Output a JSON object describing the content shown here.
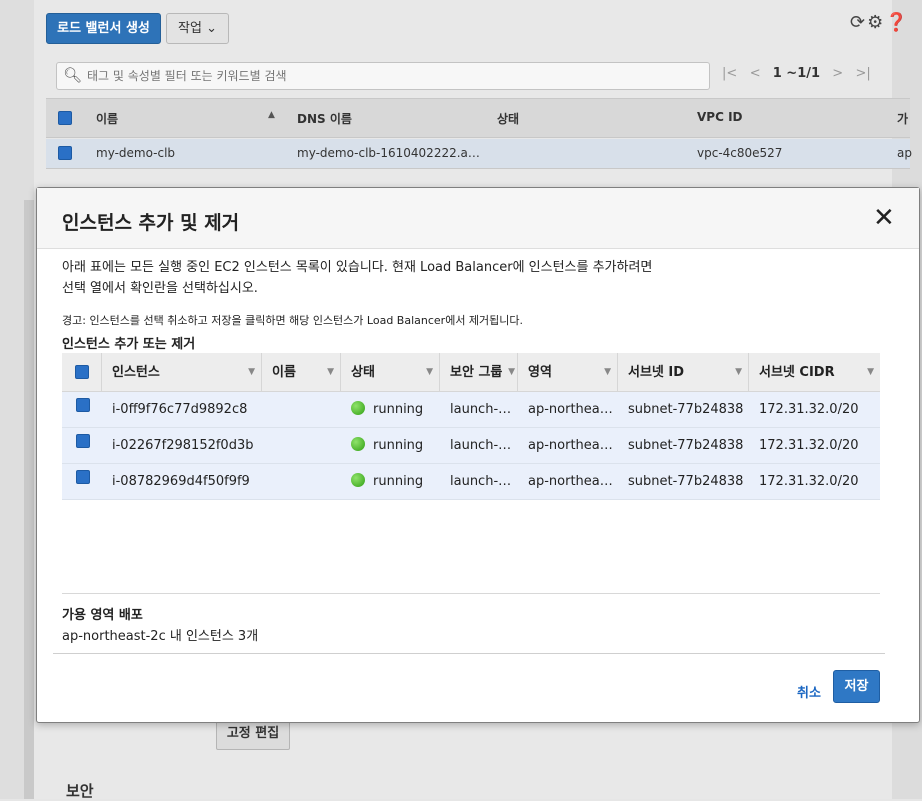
{
  "background": {
    "create_lb_button": "로드 밸런서 생성",
    "actions_button": "작업",
    "search_placeholder": "태그 및 속성별 필터 또는 키워드별 검색",
    "pagination": "1 ~1/1",
    "table": {
      "columns": [
        "이름",
        "DNS 이름",
        "상태",
        "VPC ID",
        "가"
      ],
      "row": {
        "name": "my-demo-clb",
        "dns": "my-demo-clb-1610402222.a…",
        "status": "",
        "vpc": "vpc-4c80e527",
        "extra": "ap"
      }
    },
    "edit_button": "고정 편집",
    "section_title": "보안"
  },
  "modal": {
    "title": "인스턴스 추가 및 제거",
    "close_glyph": "✕",
    "description_line1": "아래 표에는 모든 실행 중인 EC2 인스턴스 목록이 있습니다. 현재 Load Balancer에 인스턴스를 추가하려면",
    "description_line2": "선택 열에서 확인란을 선택하십시오.",
    "warning": "경고: 인스턴스를 선택 취소하고 저장을 클릭하면 해당 인스턴스가 Load Balancer에서 제거됩니다.",
    "section_title": "인스턴스 추가 또는 제거",
    "columns": [
      "인스턴스",
      "이름",
      "상태",
      "보안 그룹",
      "영역",
      "서브넷 ID",
      "서브넷 CIDR"
    ],
    "rows": [
      {
        "instance": "i-0ff9f76c77d9892c8",
        "name": "",
        "state": "running",
        "sg": "launch-…",
        "zone": "ap-northea…",
        "subnet": "subnet-77b24838",
        "cidr": "172.31.32.0/20"
      },
      {
        "instance": "i-02267f298152f0d3b",
        "name": "",
        "state": "running",
        "sg": "launch-…",
        "zone": "ap-northea…",
        "subnet": "subnet-77b24838",
        "cidr": "172.31.32.0/20"
      },
      {
        "instance": "i-08782969d4f50f9f9",
        "name": "",
        "state": "running",
        "sg": "launch-…",
        "zone": "ap-northea…",
        "subnet": "subnet-77b24838",
        "cidr": "172.31.32.0/20"
      }
    ],
    "az_title": "가용 영역 배포",
    "az_text": "ap-northeast-2c 내 인스턴스 3개",
    "cancel": "취소",
    "save": "저장"
  },
  "colors": {
    "accent": "#2e73b8",
    "running": "#2f9e13",
    "selected_row": "#eaf0fb",
    "link": "#1a66c2"
  }
}
